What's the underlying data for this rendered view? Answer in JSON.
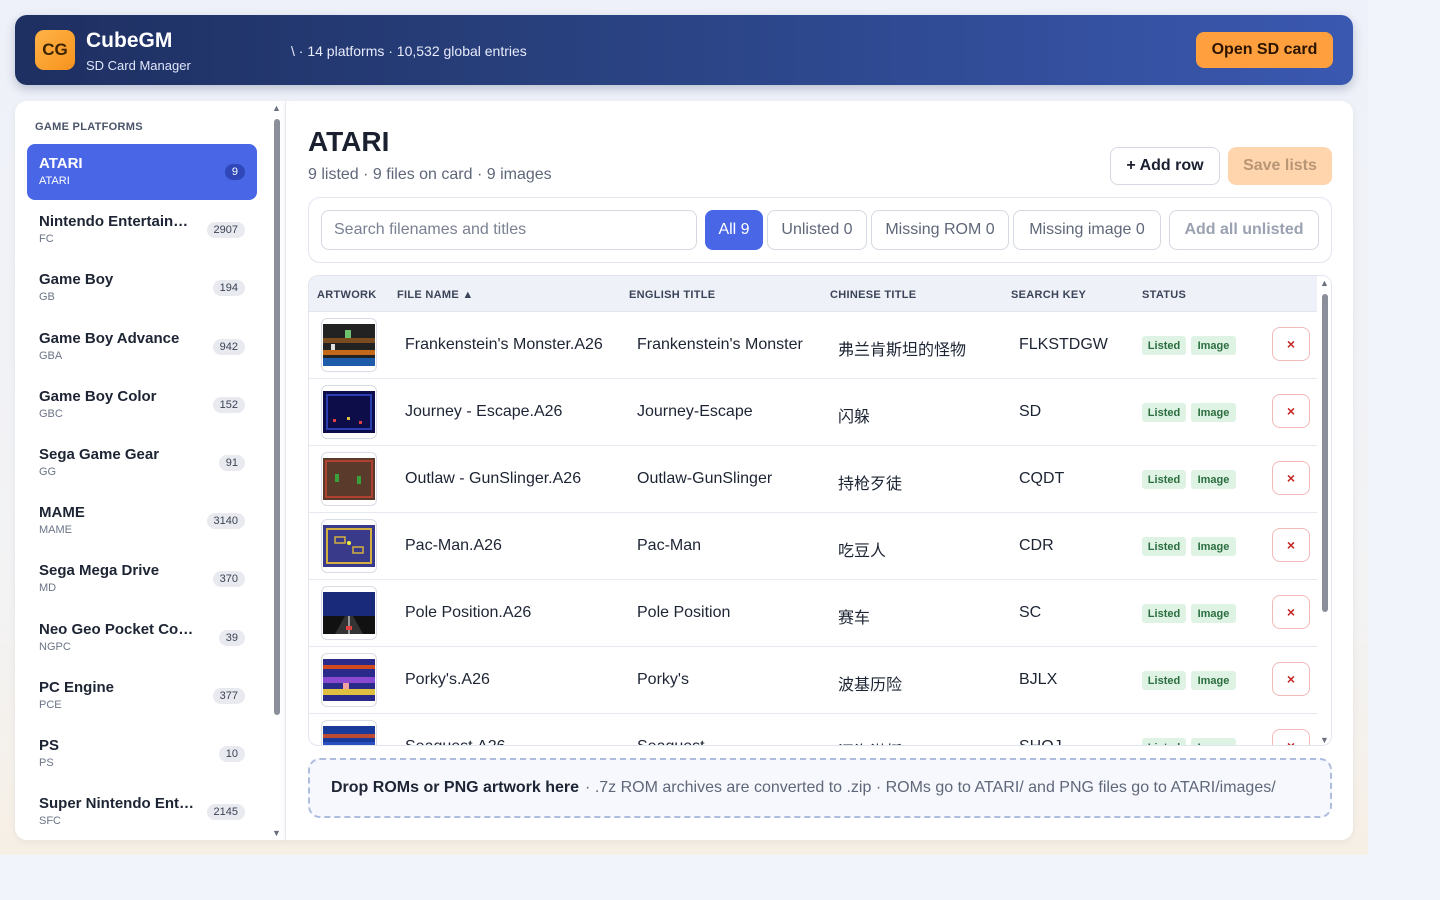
{
  "header": {
    "logo_text": "CG",
    "app_name": "CubeGM",
    "app_subtitle": "SD Card Manager",
    "path_info": "\\ · 14 platforms · 10,532 global entries",
    "open_button": "Open SD card"
  },
  "sidebar": {
    "title": "GAME PLATFORMS",
    "items": [
      {
        "name": "ATARI",
        "code": "ATARI",
        "count": "9",
        "active": true
      },
      {
        "name": "Nintendo Entertainment System",
        "code": "FC",
        "count": "2907"
      },
      {
        "name": "Game Boy",
        "code": "GB",
        "count": "194"
      },
      {
        "name": "Game Boy Advance",
        "code": "GBA",
        "count": "942"
      },
      {
        "name": "Game Boy Color",
        "code": "GBC",
        "count": "152"
      },
      {
        "name": "Sega Game Gear",
        "code": "GG",
        "count": "91"
      },
      {
        "name": "MAME",
        "code": "MAME",
        "count": "3140"
      },
      {
        "name": "Sega Mega Drive",
        "code": "MD",
        "count": "370"
      },
      {
        "name": "Neo Geo Pocket Color",
        "code": "NGPC",
        "count": "39"
      },
      {
        "name": "PC Engine",
        "code": "PCE",
        "count": "377"
      },
      {
        "name": "PS",
        "code": "PS",
        "count": "10"
      },
      {
        "name": "Super Nintendo Entertainment System",
        "code": "SFC",
        "count": "2145"
      }
    ]
  },
  "main": {
    "title": "ATARI",
    "subtitle": "9 listed · 9 files on card · 9 images",
    "add_row": "+ Add row",
    "save_lists": "Save lists",
    "search_placeholder": "Search filenames and titles",
    "filters": {
      "all": "All 9",
      "unlisted": "Unlisted 0",
      "missing_rom": "Missing ROM 0",
      "missing_image": "Missing image 0",
      "add_all_unlisted": "Add all unlisted"
    },
    "columns": {
      "artwork": "ARTWORK",
      "file_name": "FILE NAME ▲",
      "english_title": "ENGLISH TITLE",
      "chinese_title": "CHINESE TITLE",
      "search_key": "SEARCH KEY",
      "status": "STATUS"
    },
    "rows": [
      {
        "file": "Frankenstein's Monster.A26",
        "english": "Frankenstein's Monster",
        "chinese": "弗兰肯斯坦的怪物",
        "key": "FLKSTDGW",
        "listed": "Listed",
        "image": "Image",
        "delete": "×"
      },
      {
        "file": "Journey - Escape.A26",
        "english": "Journey-Escape",
        "chinese": "闪躲",
        "key": "SD",
        "listed": "Listed",
        "image": "Image",
        "delete": "×"
      },
      {
        "file": "Outlaw - GunSlinger.A26",
        "english": "Outlaw-GunSlinger",
        "chinese": "持枪歹徒",
        "key": "CQDT",
        "listed": "Listed",
        "image": "Image",
        "delete": "×"
      },
      {
        "file": "Pac-Man.A26",
        "english": "Pac-Man",
        "chinese": "吃豆人",
        "key": "CDR",
        "listed": "Listed",
        "image": "Image",
        "delete": "×"
      },
      {
        "file": "Pole Position.A26",
        "english": "Pole Position",
        "chinese": "赛车",
        "key": "SC",
        "listed": "Listed",
        "image": "Image",
        "delete": "×"
      },
      {
        "file": "Porky's.A26",
        "english": "Porky's",
        "chinese": "波基历险",
        "key": "BJLX",
        "listed": "Listed",
        "image": "Image",
        "delete": "×"
      },
      {
        "file": "Seaquest.A26",
        "english": "Seaquest",
        "chinese": "深海潜艇",
        "key": "SHQJ",
        "listed": "Listed",
        "image": "Image",
        "delete": "×"
      }
    ],
    "dropzone_bold": "Drop ROMs or PNG artwork here",
    "dropzone_text": "· .7z ROM archives are converted to .zip · ROMs go to ATARI/ and PNG files go to ATARI/images/"
  },
  "colors": {
    "accent": "#4866e6",
    "header_dark": "#1e2f61",
    "orange": "#ff9f3d",
    "listed_green": "#dff3e5",
    "delete_red": "#c62828"
  }
}
